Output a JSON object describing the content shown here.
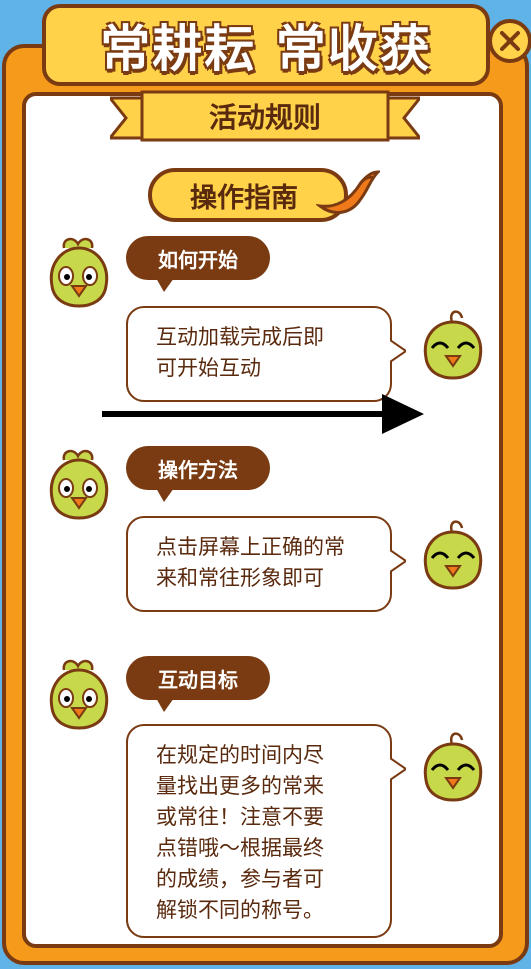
{
  "header": {
    "title": "常耕耘 常收获",
    "close_icon": "close-icon"
  },
  "ribbon": {
    "label": "活动规则"
  },
  "guide": {
    "label": "操作指南",
    "icon": "swallow-icon"
  },
  "sections": [
    {
      "label": "如何开始",
      "lines": [
        "互动加载完成后即",
        "可开始互动"
      ]
    },
    {
      "label": "操作方法",
      "lines": [
        "点击屏幕上正确的常",
        "来和常往形象即可"
      ]
    },
    {
      "label": "互动目标",
      "lines": [
        "在规定的时间内尽",
        "量找出更多的常来",
        "或常往！注意不要",
        "点错哦～根据最终",
        "的成绩，参与者可",
        "解锁不同的称号。"
      ]
    }
  ],
  "colors": {
    "frame": "#f59a1b",
    "border": "#7a3a12",
    "title": "#ffd24a",
    "sky": "#5fb3e6",
    "mascot": "#c7d94a"
  }
}
